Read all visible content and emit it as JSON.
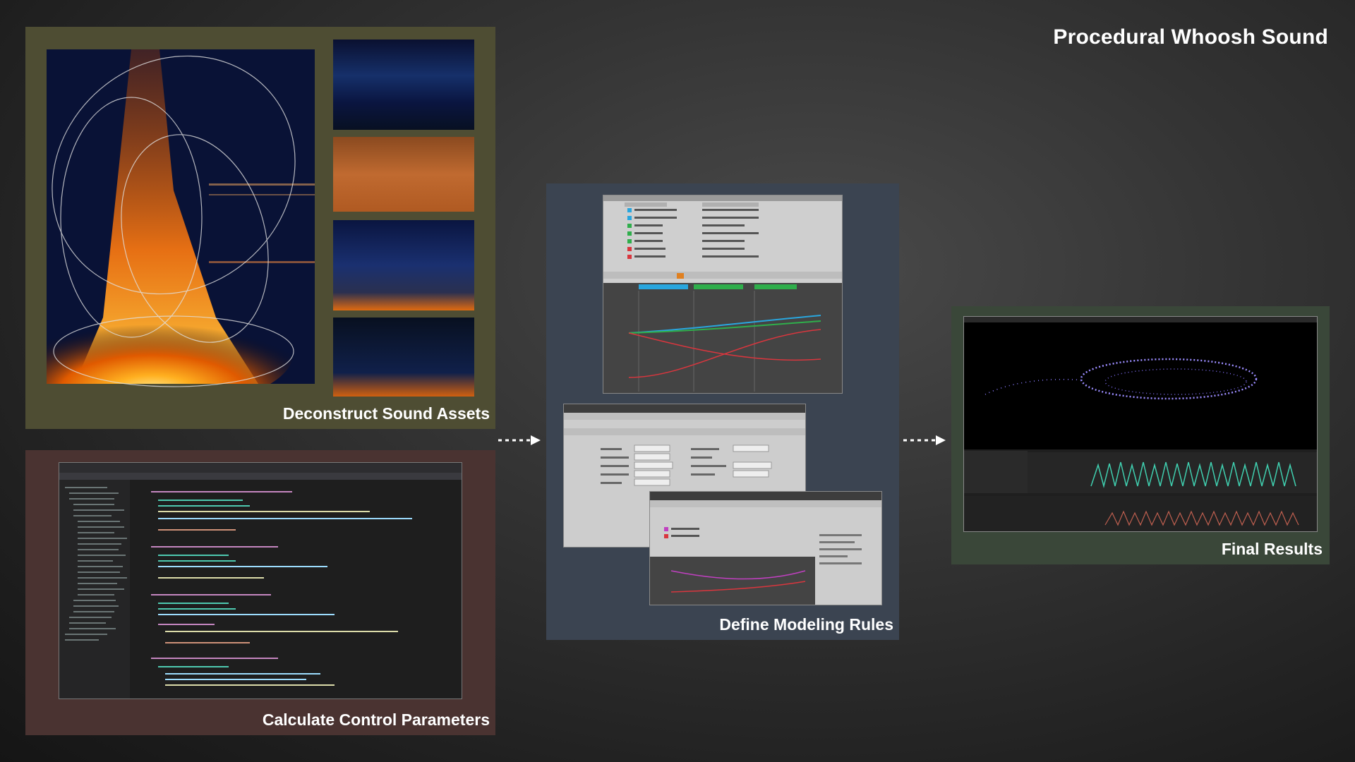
{
  "title": "Procedural Whoosh Sound",
  "stages": {
    "deconstruct": "Deconstruct Sound Assets",
    "calculate": "Calculate Control Parameters",
    "modeling": "Define Modeling Rules",
    "final": "Final Results"
  },
  "colors": {
    "panel_deconstruct": "#4e4d33",
    "panel_calculate": "#4a3331",
    "panel_modeling": "#3b4451",
    "panel_final": "#3a4739"
  }
}
